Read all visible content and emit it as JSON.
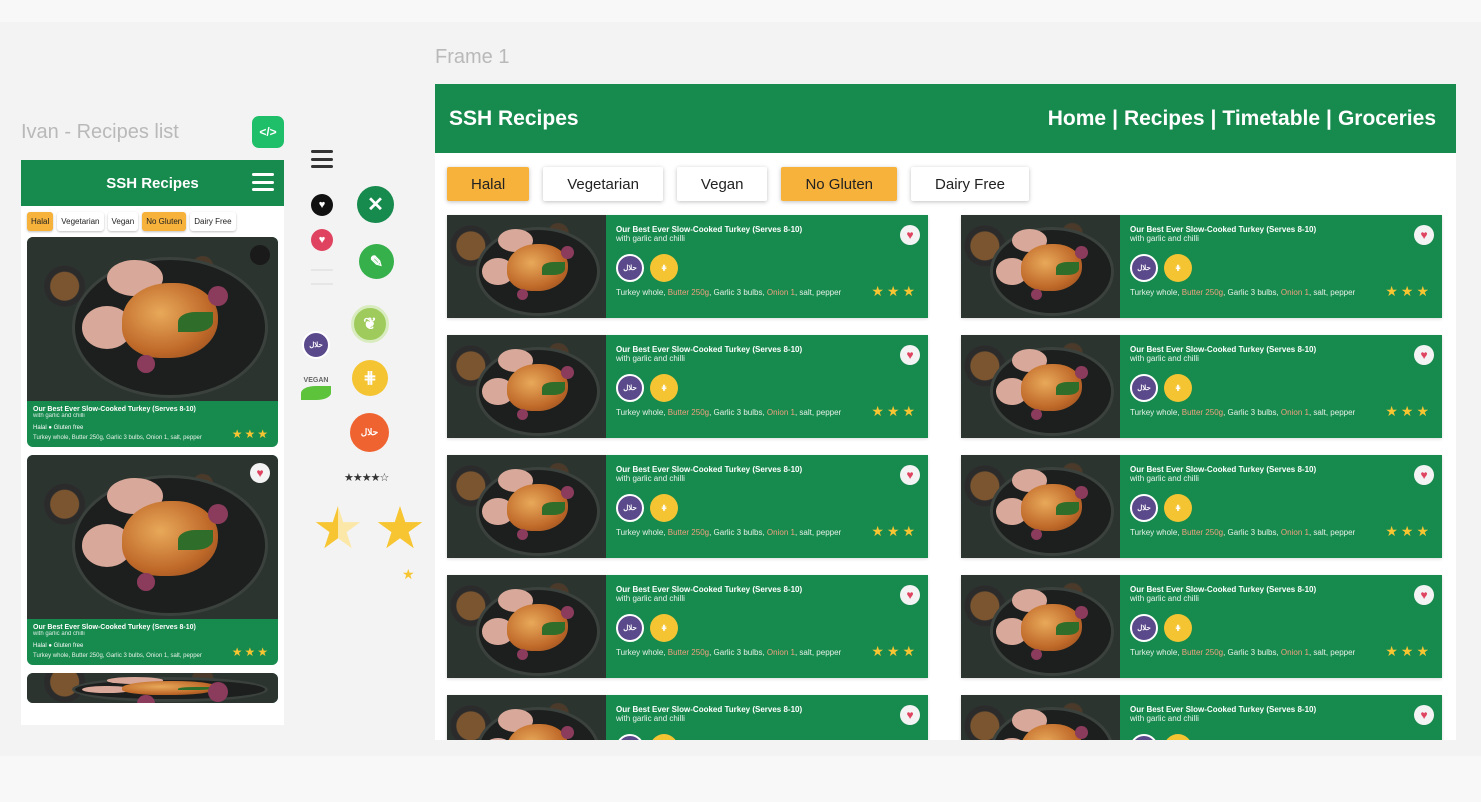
{
  "labels": {
    "mobile_frame": "Ivan - Recipes list",
    "desktop_frame": "Frame 1",
    "code_icon": "</>"
  },
  "mobile": {
    "brand": "SSH Recipes",
    "filters": [
      {
        "label": "Halal",
        "active": true
      },
      {
        "label": "Vegetarian",
        "active": false
      },
      {
        "label": "Vegan",
        "active": false
      },
      {
        "label": "No Gluten",
        "active": true
      },
      {
        "label": "Dairy Free",
        "active": false
      }
    ],
    "cards": [
      {
        "title": "Our Best Ever Slow-Cooked Turkey (Serves 8-10)",
        "subtitle": "with garlic and chilli",
        "tags": "Halal ● Gluten free",
        "ingredients": "Turkey whole, Butter 250g, Garlic 3 bulbs, Onion 1, salt, pepper",
        "rating": 3
      },
      {
        "title": "Our Best Ever Slow-Cooked Turkey (Serves 8-10)",
        "subtitle": "with garlic and chilli",
        "tags": "Halal ● Gluten free",
        "ingredients": "Turkey whole, Butter 250g, Garlic 3 bulbs, Onion 1, salt, pepper",
        "rating": 3
      }
    ]
  },
  "assets": {
    "vegan_label": "VEGAN",
    "rating_row": "★★★★☆"
  },
  "desktop": {
    "brand": "SSH Recipes",
    "nav": [
      "Home",
      "|",
      "Recipes",
      "|",
      "Timetable",
      "|",
      "Groceries"
    ],
    "filters": [
      {
        "label": "Halal",
        "active": true
      },
      {
        "label": "Vegetarian",
        "active": false
      },
      {
        "label": "Vegan",
        "active": false
      },
      {
        "label": "No Gluten",
        "active": true
      },
      {
        "label": "Dairy Free",
        "active": false
      }
    ],
    "card": {
      "title": "Our Best Ever Slow-Cooked Turkey (Serves 8-10)",
      "subtitle": "with garlic and chilli",
      "ingredients": [
        "Turkey whole, ",
        "Butter 250g",
        ", Garlic 3 bulbs, ",
        "Onion 1",
        ", salt, pepper"
      ],
      "rating": 3
    },
    "card_count": 10
  },
  "colors": {
    "brand_green": "#178a4e",
    "accent_orange": "#f7b23b",
    "star_yellow": "#f7c531",
    "heart_red": "#e0435f"
  }
}
